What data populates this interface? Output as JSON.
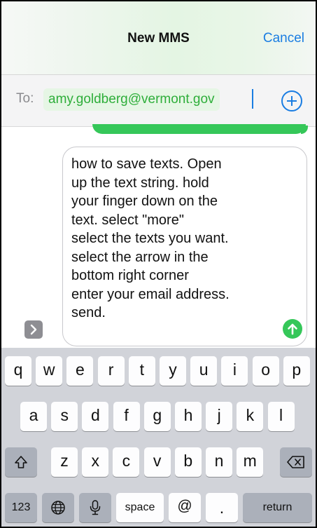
{
  "header": {
    "title": "New MMS",
    "cancel_label": "Cancel"
  },
  "to_field": {
    "label": "To:",
    "recipient": "amy.goldberg@vermont.gov"
  },
  "compose": {
    "text": "how to save texts. Open\nup the text string. hold\nyour finger down on the\ntext. select \"more\"\nselect the texts you want.\nselect the arrow in the\nbottom right corner\nenter your email address.\nsend."
  },
  "colors": {
    "accent": "#1a7de2",
    "imessage_green": "#35c759",
    "recipient_green": "#2eae3a"
  },
  "keyboard": {
    "row1": [
      "q",
      "w",
      "e",
      "r",
      "t",
      "y",
      "u",
      "i",
      "o",
      "p"
    ],
    "row2": [
      "a",
      "s",
      "d",
      "f",
      "g",
      "h",
      "j",
      "k",
      "l"
    ],
    "row3": [
      "z",
      "x",
      "c",
      "v",
      "b",
      "n",
      "m"
    ],
    "numbers_label": "123",
    "space_label": "space",
    "at_label": "@",
    "period_label": ".",
    "return_label": "return",
    "icons": [
      "shift-icon",
      "backspace-icon",
      "globe-icon",
      "microphone-icon"
    ]
  }
}
